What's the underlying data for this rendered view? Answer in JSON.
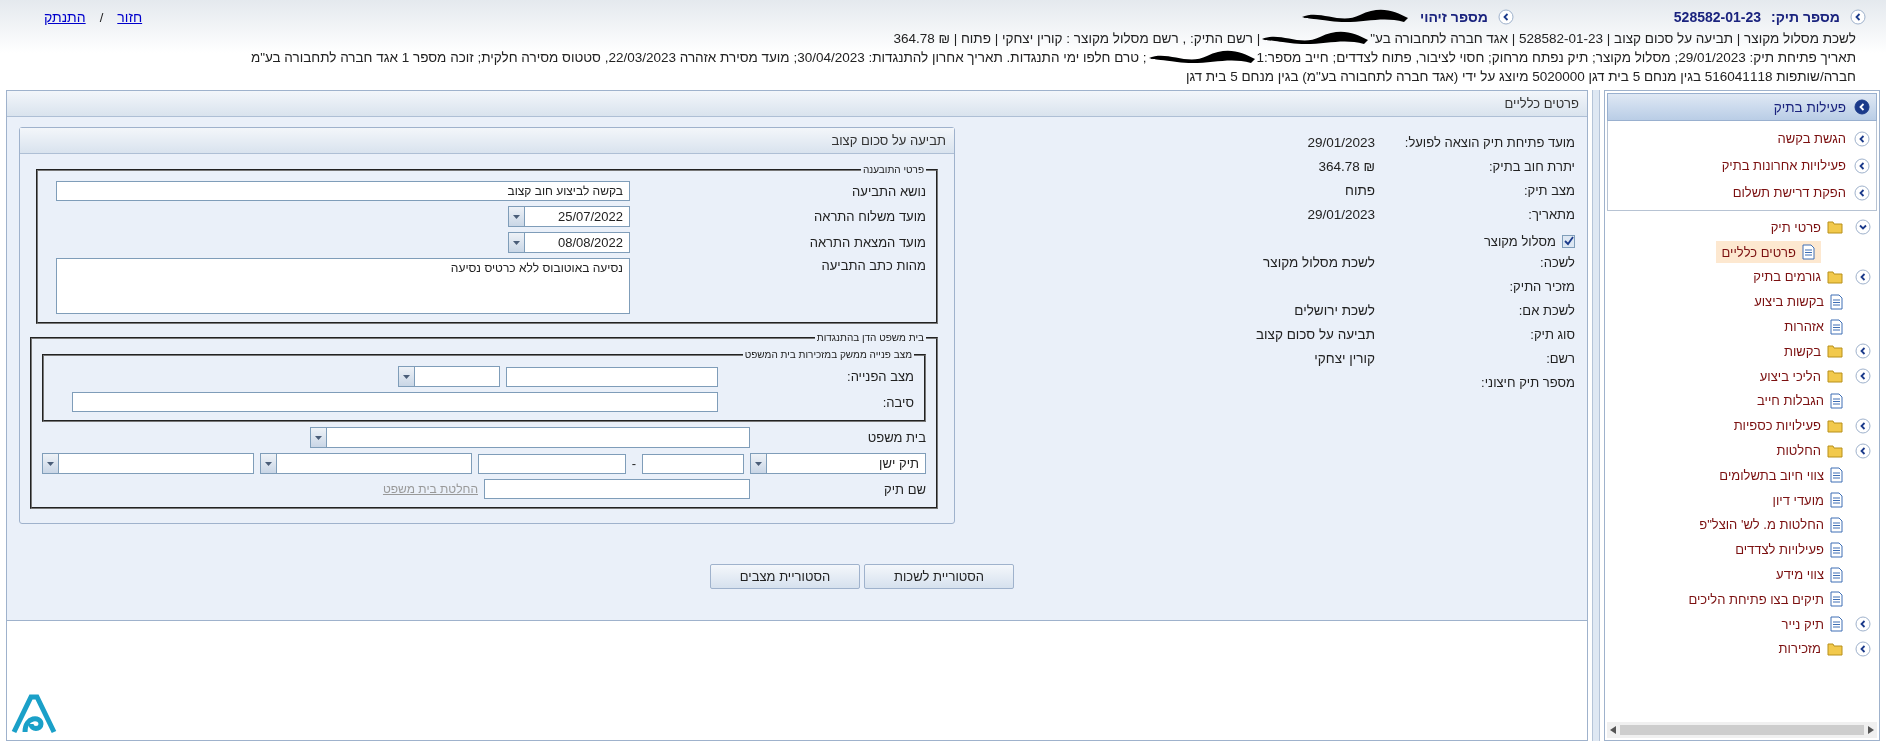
{
  "header": {
    "case_label": "מספר תיק:",
    "case_number": "528582-01-23",
    "id_label": "מספר זיהוי",
    "links": [
      {
        "label": "חזור"
      },
      {
        "label": "התנתק"
      }
    ],
    "link_separator": "/",
    "lines": [
      [
        {
          "kind": "text",
          "text": "לשכת מסלול מקוצר | תביעה על סכום קצוב | 528582-01-23 | אגד חברה לתחבורה בע\""
        },
        {
          "kind": "redacted"
        },
        {
          "kind": "text",
          "text": "| רשם התיק: , רשם מסלול מקוצר : קורין יצחקי | פתוח | ₪ 364.78"
        }
      ],
      [
        {
          "kind": "text",
          "text": "תאריך פתיחת תיק: 29/01/2023; מסלול מקוצר; תיק נפתח מרחוק; חסוי לציבור, פתוח לצדדים; חייב מספר:1"
        },
        {
          "kind": "redacted"
        },
        {
          "kind": "text",
          "text": "; טרם חלפו ימי התנגדות. תאריך אחרון להתנגדות: 30/04/2023; מועד מסירת אזהרה 22/03/2023, סטטוס מסירה חלקית; זוכה מספר 1 אגד חברה לתחבורה בע\"מ"
        }
      ],
      [
        {
          "kind": "text",
          "text": "חברה/שותפות 516041118 בגין מנחם 5 בית דגן 5020000 מיוצג על ידי (אגד חברה לתחבורה בע\"מ) בגין מנחם 5 בית דגן"
        }
      ]
    ]
  },
  "main": {
    "title": "פרטים כלליים",
    "details": [
      {
        "kind": "field",
        "label": "מועד פתיחת תיק הוצאה לפועל:",
        "value": "29/01/2023"
      },
      {
        "kind": "field",
        "label": "יתרת חוב בתיק:",
        "value": "₪ 364.78"
      },
      {
        "kind": "field",
        "label": "מצב תיק:",
        "value": "פתוח"
      },
      {
        "kind": "field",
        "label": "מתאריך:",
        "value": "29/01/2023"
      },
      {
        "kind": "checkbox",
        "label": "מסלול מקוצר",
        "checked": true
      },
      {
        "kind": "field",
        "label": "לשכה:",
        "value": "לשכת מסלול מקוצר"
      },
      {
        "kind": "field",
        "label": "מזכיר התיק:"
      },
      {
        "kind": "field",
        "label": "לשכת אם:",
        "value": "לשכת ירושלים"
      },
      {
        "kind": "field",
        "label": "סוג תיק:",
        "value": "תביעה על סכום קצוב"
      },
      {
        "kind": "field",
        "label": "רשם:",
        "value": "קורין יצחקי"
      },
      {
        "kind": "field",
        "label": "מספר תיק חיצוני:"
      }
    ],
    "claim": {
      "title": "תביעה על סכום קצוב",
      "details_group": {
        "legend": "פרטי התובענה",
        "subject": {
          "label": "נושא התביעה",
          "value": "בקשה לביצוע חוב קצוב"
        },
        "sent_date": {
          "label": "מועד משלוח התראה",
          "value": "25/07/2022"
        },
        "shown_date": {
          "label": "מועד המצאת התראה",
          "value": "08/08/2022"
        },
        "nature": {
          "label": "מהות כתב התביעה",
          "value": "נסיעה באוטובוס ללא כרטיס נסיעה"
        }
      },
      "court_group": {
        "legend": "בית משפט הדן בהתנגדות",
        "inner_legend": "מצב פנייה ממשק במזכירות בית המשפט",
        "status_label": "מצב הפנייה:",
        "reason_label": "סיבה:",
        "court_label": "בית משפט",
        "old_case": "תיק ישן",
        "separator": "-",
        "case_name_label": "שם תיק",
        "decision_link": {
          "label": "החלטת בית משפט",
          "disabled": true
        }
      }
    },
    "buttons": [
      {
        "label": "הסטוריית לשכות"
      },
      {
        "label": "הסטוריית מצבים"
      }
    ]
  },
  "sidebar": {
    "title": "פעילות בתיק",
    "actions": [
      {
        "label": "הגשת בקשה"
      },
      {
        "label": "פעילויות אחרונות בתיק"
      },
      {
        "label": "הפקת דרישת תשלום"
      }
    ],
    "tree": [
      {
        "label": "פרטי תיק",
        "kind": "folder",
        "expanded": true,
        "selected": false,
        "children": [
          {
            "label": "פרטים כלליים",
            "kind": "doc",
            "selected": true
          }
        ]
      },
      {
        "label": "גורמים בתיק",
        "kind": "folder",
        "expanded": false,
        "selected": false
      },
      {
        "label": "בקשות ביצוע",
        "kind": "doc",
        "selected": false
      },
      {
        "label": "אזהרות",
        "kind": "doc",
        "selected": false
      },
      {
        "label": "בקשות",
        "kind": "folder",
        "expanded": false,
        "selected": false
      },
      {
        "label": "הליכי ביצוע",
        "kind": "folder",
        "expanded": false,
        "selected": false
      },
      {
        "label": "הגבלות חייב",
        "kind": "doc",
        "selected": false
      },
      {
        "label": "פעילויות כספיות",
        "kind": "folder",
        "expanded": false,
        "selected": false
      },
      {
        "label": "החלטות",
        "kind": "folder",
        "expanded": false,
        "selected": false
      },
      {
        "label": "צווי חיוב בתשלומים",
        "kind": "doc",
        "selected": false
      },
      {
        "label": "מועדי דיון",
        "kind": "doc",
        "selected": false
      },
      {
        "label": "החלטות מ. לש' הוצל\"פ",
        "kind": "doc",
        "selected": false
      },
      {
        "label": "פעילויות לצדדים",
        "kind": "doc",
        "selected": false
      },
      {
        "label": "צווי מידע",
        "kind": "doc",
        "selected": false
      },
      {
        "label": "תיקים בצו פתיחת הליכים",
        "kind": "doc",
        "selected": false
      },
      {
        "label": "תיק נייר",
        "kind": "doc",
        "expanded": false,
        "selected": false
      },
      {
        "label": "מזכירות",
        "kind": "folder",
        "expanded": false,
        "selected": false
      }
    ]
  }
}
